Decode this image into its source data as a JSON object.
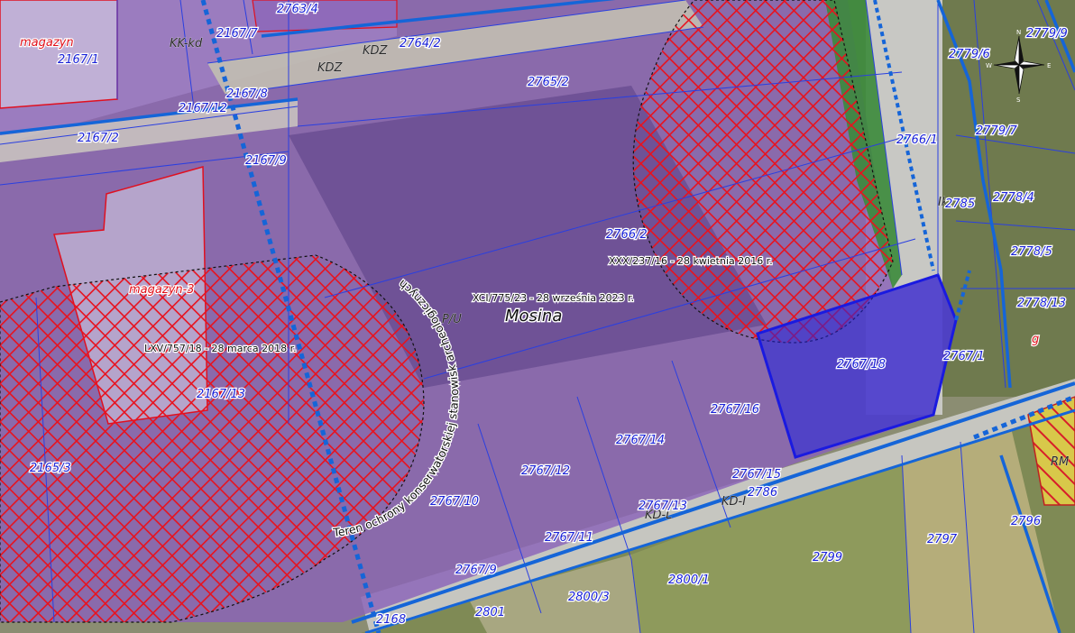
{
  "map": {
    "locality": "Mosina",
    "colors": {
      "planned_zone_fill": "#8a63b8",
      "protection_zone": "#e8121e",
      "selected_parcel": "#2222dd",
      "parcel_label": "#1a22d8",
      "road_boundary": "#1565d8"
    },
    "resolutions": [
      "XCI/775/23 - 28 września 2023 r.",
      "XXX/237/16 - 28 kwietnia 2016 r.",
      "LXV/757/18 - 28 marca 2018 r."
    ],
    "protection_zone_caption": "Teren ochrony konserwatorskiej stanowisk archeologicznych",
    "zone_symbols": [
      "P/U",
      "KDZ",
      "KDZ",
      "KK-kd",
      "KD-L",
      "KD-I",
      "RM",
      "Ik"
    ],
    "building_labels": [
      "magazyn",
      "magazyn-3",
      "g"
    ],
    "parcels": [
      "2167/1",
      "2167/7",
      "2167/8",
      "2167/12",
      "2167/2",
      "2167/9",
      "2763/4",
      "2764/2",
      "2765/2",
      "2766/2",
      "2766/1",
      "2785",
      "2767/18",
      "2767/16",
      "2767/14",
      "2767/12",
      "2767/10",
      "2767/15",
      "2767/13",
      "2786",
      "2767/11",
      "2767/9",
      "2767/1",
      "2167/13",
      "2165/3",
      "2168",
      "2801",
      "2800/3",
      "2800/1",
      "2799",
      "2797",
      "2796",
      "2779/6",
      "2779/9",
      "2779/7",
      "2778/4",
      "2778/5",
      "2778/13"
    ],
    "compass": {
      "icon": "compass-rose-icon",
      "north": "N",
      "west": "W",
      "east": "E",
      "south": "S"
    }
  }
}
